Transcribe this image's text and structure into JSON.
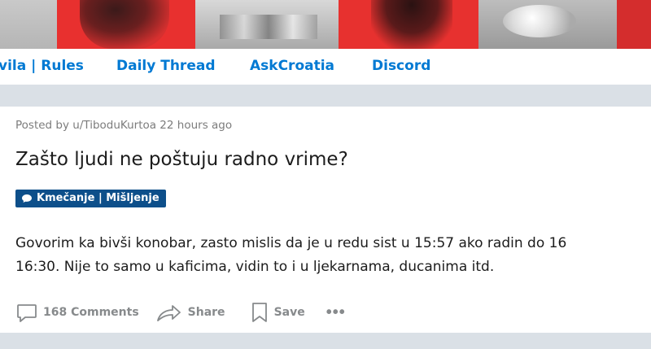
{
  "nav": {
    "links": [
      "vila | Rules",
      "Daily Thread",
      "AskCroatia",
      "Discord"
    ]
  },
  "post": {
    "posted_by": "Posted by u/TiboduKurtoa 22 hours ago",
    "title": "Zašto ljudi ne poštuju radno vrime?",
    "flair": "Kmečanje | Mišljenje",
    "body_line1": "Govorim ka bivši konobar, zasto mislis da je u redu sist u 15:57 ako radin do 16",
    "body_line2": "16:30. Nije to samo u kaficima, vidin to i u ljekarnama, ducanima itd.",
    "actions": {
      "comments": "168 Comments",
      "share": "Share",
      "save": "Save",
      "more": "•••"
    }
  },
  "colors": {
    "link": "#0079d3",
    "flair_bg": "#0d4f8a",
    "meta": "#7c7c7c",
    "page_bg": "#dae0e6"
  },
  "icons": [
    "comment-bubble-icon",
    "share-arrow-icon",
    "bookmark-icon",
    "more-options-icon",
    "speech-bubble-icon"
  ]
}
